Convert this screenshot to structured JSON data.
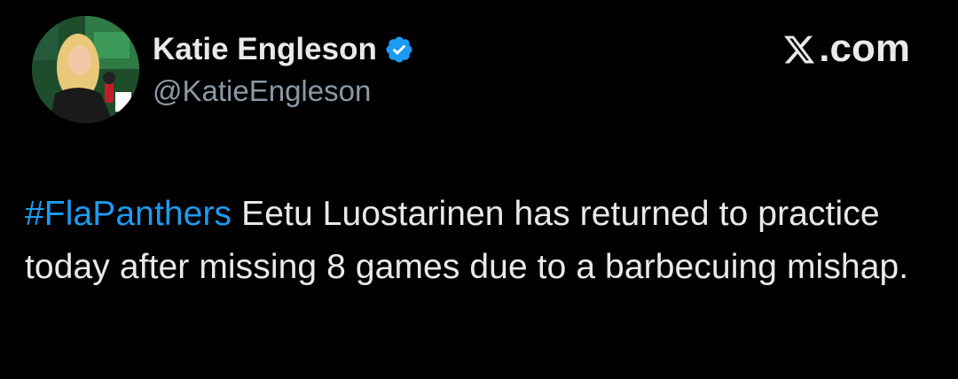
{
  "colors": {
    "background": "#000000",
    "text_primary": "#e7e9ea",
    "text_secondary": "#8b98a5",
    "link": "#1d9bf0",
    "verified_badge": "#1d9bf0"
  },
  "author": {
    "name": "Katie Engleson",
    "handle": "@KatieEngleson",
    "verified_icon": "verified-badge-icon",
    "avatar_icon": "profile-photo"
  },
  "brand": {
    "logo_icon": "x-logo-icon",
    "suffix": ".com"
  },
  "tweet": {
    "hashtag": "#FlaPanthers",
    "body": " Eetu Luostarinen has returned to practice today after missing 8 games due to a barbecuing mishap."
  }
}
